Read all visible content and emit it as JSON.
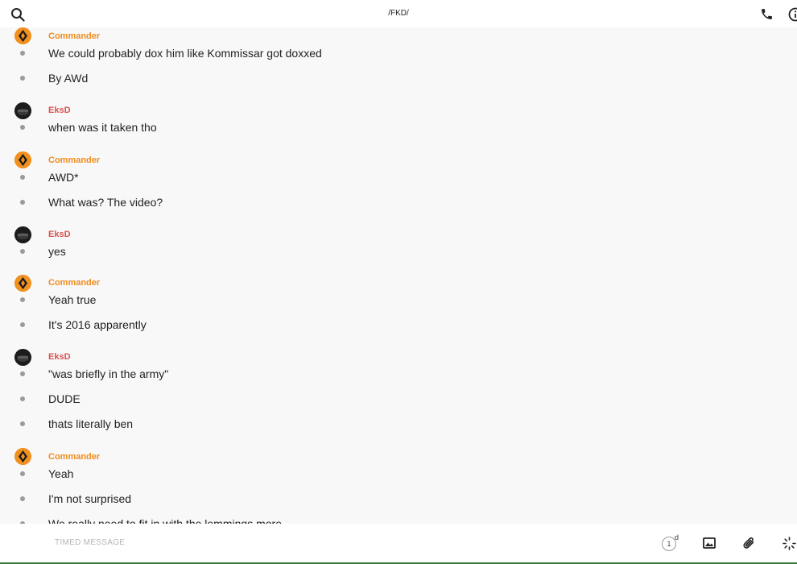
{
  "header": {
    "title": "/FKD/",
    "search_icon": "search-icon",
    "call_icon": "phone-icon",
    "info_icon": "info-icon"
  },
  "messages": [
    {
      "sender": "Commander",
      "text": "We could probably dox him like Kommissar got doxxed"
    },
    {
      "text": "By AWd"
    },
    {
      "sender": "EksD",
      "text": "when was it taken tho"
    },
    {
      "sender": "Commander",
      "text": "AWD*"
    },
    {
      "text": "What was? The video?"
    },
    {
      "sender": "EksD",
      "text": "yes"
    },
    {
      "sender": "Commander",
      "text": "Yeah true"
    },
    {
      "text": "It's 2016 apparently"
    },
    {
      "sender": "EksD",
      "text": "\"was briefly in the army\""
    },
    {
      "text": "DUDE"
    },
    {
      "text": "thats literally ben"
    },
    {
      "sender": "Commander",
      "text": "Yeah"
    },
    {
      "text": "I'm not surprised"
    },
    {
      "text": "We really need to fit in with the lemmings more"
    }
  ],
  "composer": {
    "placeholder": "TIMED MESSAGE",
    "timer_value": "1",
    "timer_unit": "d"
  },
  "colors": {
    "commander": "#f08c1c",
    "eksd": "#d9534f"
  }
}
